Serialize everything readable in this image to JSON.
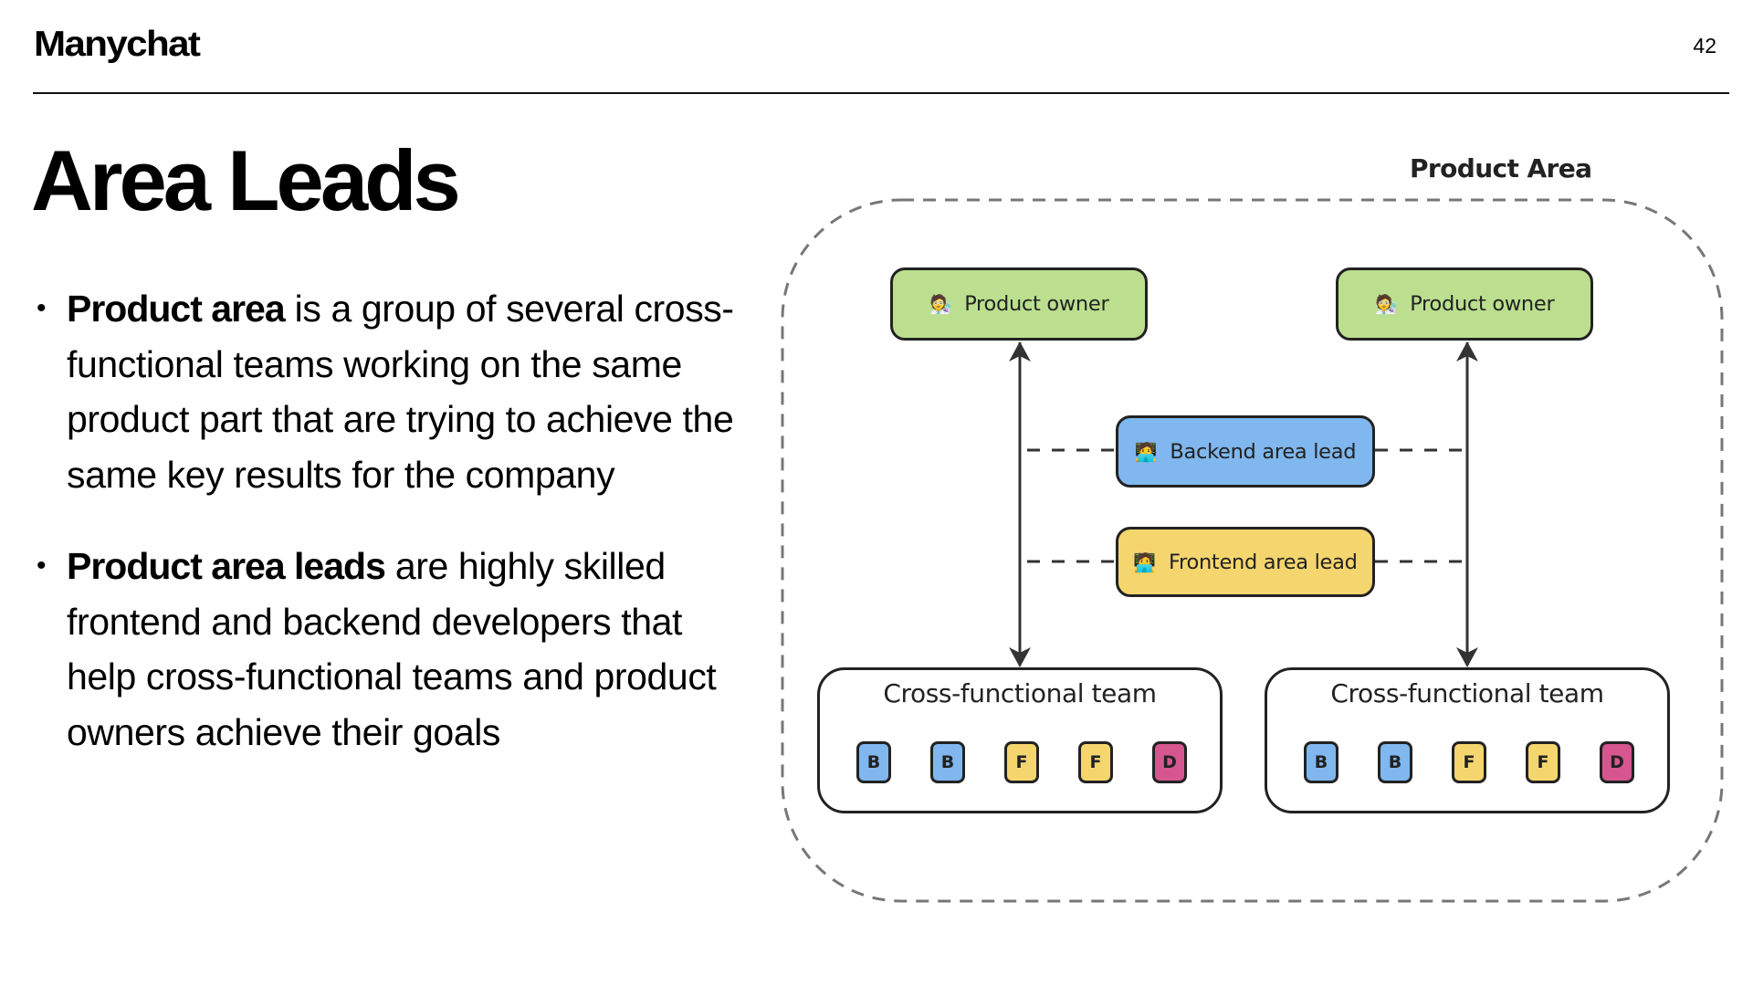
{
  "header": {
    "logo": "Manychat",
    "page_number": "42"
  },
  "slide": {
    "title": "Area Leads",
    "bullets": [
      {
        "bold": "Product area",
        "text": " is a group of several cross-functional teams working on the same product part that are trying to achieve the same key results for the company"
      },
      {
        "bold": "Product area leads",
        "text": " are highly skilled frontend and backend developers that help cross-functional teams and product owners achieve their goals"
      }
    ]
  },
  "diagram": {
    "area_label": "Product Area",
    "product_owners": [
      {
        "label": "Product owner",
        "icon": "scientist-emoji",
        "glyph": "🧑‍🔬",
        "color": "#bbdf8f"
      },
      {
        "label": "Product owner",
        "icon": "scientist-emoji",
        "glyph": "🧑‍🔬",
        "color": "#bbdf8f"
      }
    ],
    "leads": [
      {
        "label": "Backend area lead",
        "icon": "technologist-emoji",
        "glyph": "🧑‍💻",
        "color": "#7fb7ee"
      },
      {
        "label": "Frontend area lead",
        "icon": "technologist-emoji",
        "glyph": "🧑‍💻",
        "color": "#f5d56e"
      }
    ],
    "teams": [
      {
        "title": "Cross-functional team",
        "members": [
          "B",
          "B",
          "F",
          "F",
          "D"
        ]
      },
      {
        "title": "Cross-functional team",
        "members": [
          "B",
          "B",
          "F",
          "F",
          "D"
        ]
      }
    ],
    "member_colors": {
      "B": "#7fb7ee",
      "F": "#f5d56e",
      "D": "#d6568f"
    },
    "connections": [
      {
        "from": "product-owner-1",
        "to": "team-1",
        "style": "solid-double-arrow"
      },
      {
        "from": "product-owner-2",
        "to": "team-2",
        "style": "solid-double-arrow"
      },
      {
        "from": "backend-area-lead",
        "to": "vertical-links",
        "style": "dashed"
      },
      {
        "from": "frontend-area-lead",
        "to": "vertical-links",
        "style": "dashed"
      }
    ]
  }
}
